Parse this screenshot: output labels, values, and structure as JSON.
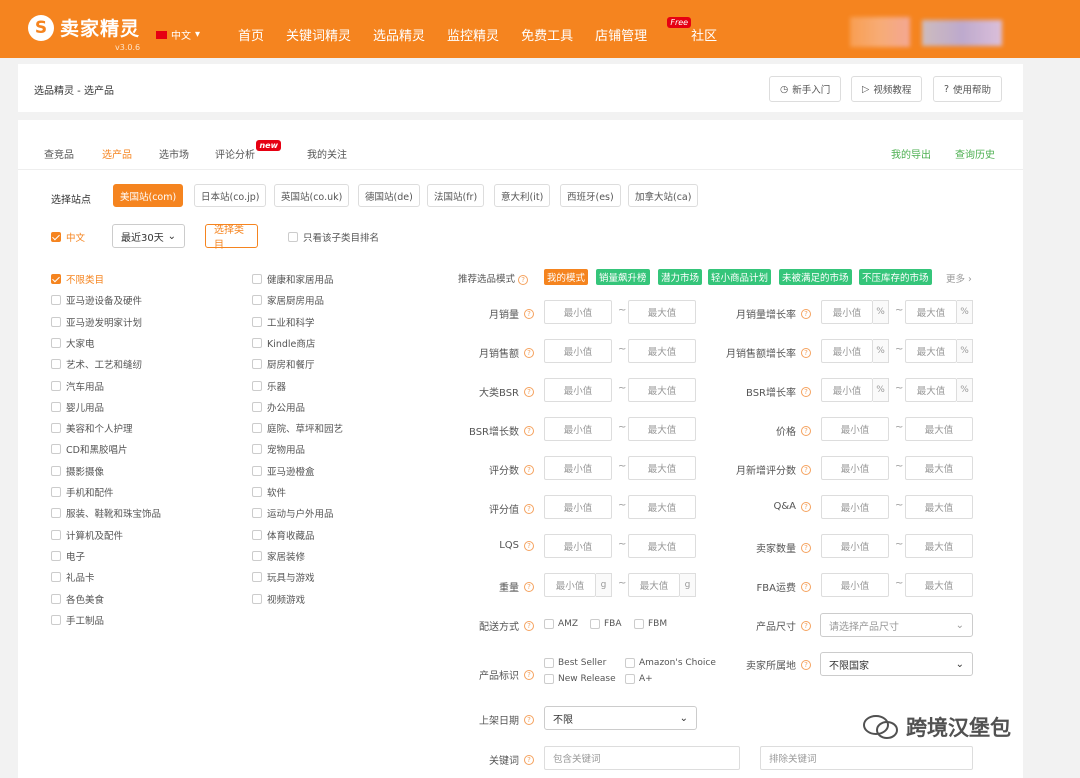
{
  "header": {
    "logo_text": "卖家精灵",
    "version": "v3.0.6",
    "lang": "中文",
    "nav": [
      "首页",
      "关键词精灵",
      "选品精灵",
      "监控精灵",
      "免费工具",
      "店铺管理",
      "社区"
    ],
    "free_badge": "Free"
  },
  "topbar": {
    "breadcrumb": "选品精灵 - 选产品",
    "buttons": [
      "新手入门",
      "视频教程",
      "使用帮助"
    ]
  },
  "tabs": {
    "items": [
      "查竞品",
      "选产品",
      "选市场",
      "评论分析",
      "我的关注"
    ],
    "new_badge": "new",
    "right_links": [
      "我的导出",
      "查询历史"
    ]
  },
  "filters": {
    "site_label": "选择站点",
    "sites": [
      "美国站(com)",
      "日本站(co.jp)",
      "英国站(co.uk)",
      "德国站(de)",
      "法国站(fr)",
      "意大利(it)",
      "西班牙(es)",
      "加拿大站(ca)"
    ],
    "lang_check": "中文",
    "period": "最近30天",
    "select_category": "选择类目",
    "only_sub": "只看该子类目排名"
  },
  "categories_col1": [
    "不限类目",
    "亚马逊设备及硬件",
    "亚马逊发明家计划",
    "大家电",
    "艺术、工艺和缝纫",
    "汽车用品",
    "婴儿用品",
    "美容和个人护理",
    "CD和黑胶唱片",
    "摄影摄像",
    "手机和配件",
    "服装、鞋靴和珠宝饰品",
    "计算机及配件",
    "电子",
    "礼品卡",
    "各色美食",
    "手工制品"
  ],
  "categories_col2": [
    "健康和家居用品",
    "家居厨房用品",
    "工业和科学",
    "Kindle商店",
    "厨房和餐厅",
    "乐器",
    "办公用品",
    "庭院、草坪和园艺",
    "宠物用品",
    "亚马逊橙盒",
    "软件",
    "运动与户外用品",
    "体育收藏品",
    "家居装修",
    "玩具与游戏",
    "视频游戏"
  ],
  "modes": {
    "label": "推荐选品模式",
    "items": [
      "我的模式",
      "销量飙升榜",
      "潜力市场",
      "轻小商品计划",
      "未被满足的市场",
      "不压库存的市场"
    ],
    "more": "更多"
  },
  "ranges_left": [
    "月销量",
    "月销售额",
    "大类BSR",
    "BSR增长数",
    "评分数",
    "评分值",
    "LQS",
    "重量"
  ],
  "ranges_right": [
    "月销量增长率",
    "月销售额增长率",
    "BSR增长率",
    "价格",
    "月新增评分数",
    "Q&A",
    "卖家数量",
    "FBA运费"
  ],
  "placeholders": {
    "min": "最小值",
    "max": "最大值",
    "dash": "~",
    "pct": "%",
    "g": "g"
  },
  "shipping": {
    "label": "配送方式",
    "options": [
      "AMZ",
      "FBA",
      "FBM"
    ]
  },
  "size": {
    "label": "产品尺寸",
    "placeholder": "请选择产品尺寸"
  },
  "tags": {
    "label": "产品标识",
    "options": [
      "Best Seller",
      "Amazon's Choice",
      "New Release",
      "A+"
    ]
  },
  "seller_loc": {
    "label": "卖家所属地",
    "value": "不限国家"
  },
  "listed": {
    "label": "上架日期",
    "value": "不限"
  },
  "keyword": {
    "label": "关键词",
    "include": "包含关键词",
    "exclude": "排除关键词"
  },
  "watermark": "跨境汉堡包",
  "colors": {
    "brand": "#f5841f",
    "green": "#35c57a"
  }
}
